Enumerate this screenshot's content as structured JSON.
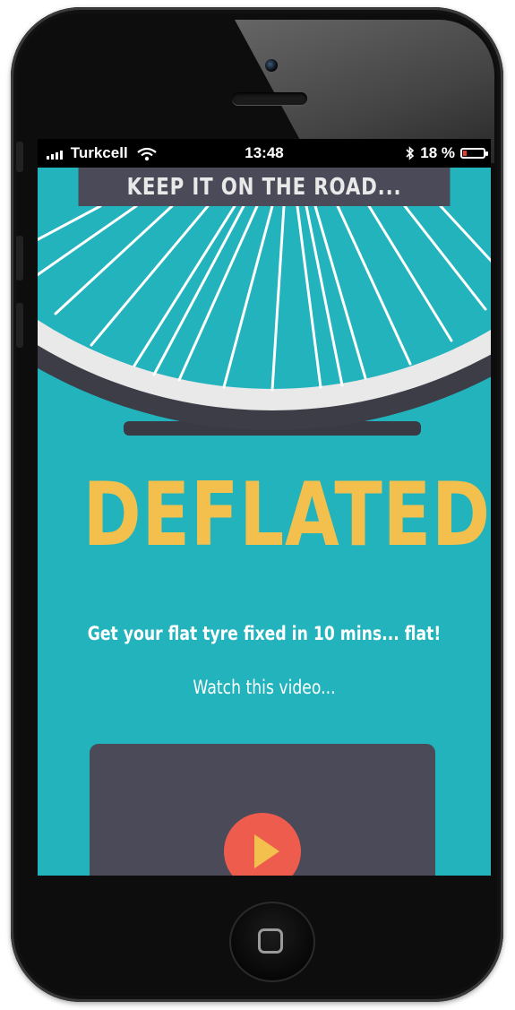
{
  "status_bar": {
    "carrier": "Turkcell",
    "time": "13:48",
    "battery": "18 %",
    "battery_level": 0.18
  },
  "header": {
    "title": "KEEP IT ON THE ROAD..."
  },
  "hero": {
    "headline": "DEFLATED?"
  },
  "content": {
    "subtitle": "Get your flat tyre fixed in 10 mins... flat!",
    "watch_text": "Watch this video..."
  },
  "colors": {
    "screen_bg": "#22b3bd",
    "bar_bg": "#4a4a58",
    "headline": "#f3c04d",
    "play_button": "#ee5c4e"
  },
  "icons": [
    "signal-icon",
    "wifi-icon",
    "bluetooth-icon",
    "battery-icon",
    "wheel-illustration",
    "play-icon"
  ]
}
